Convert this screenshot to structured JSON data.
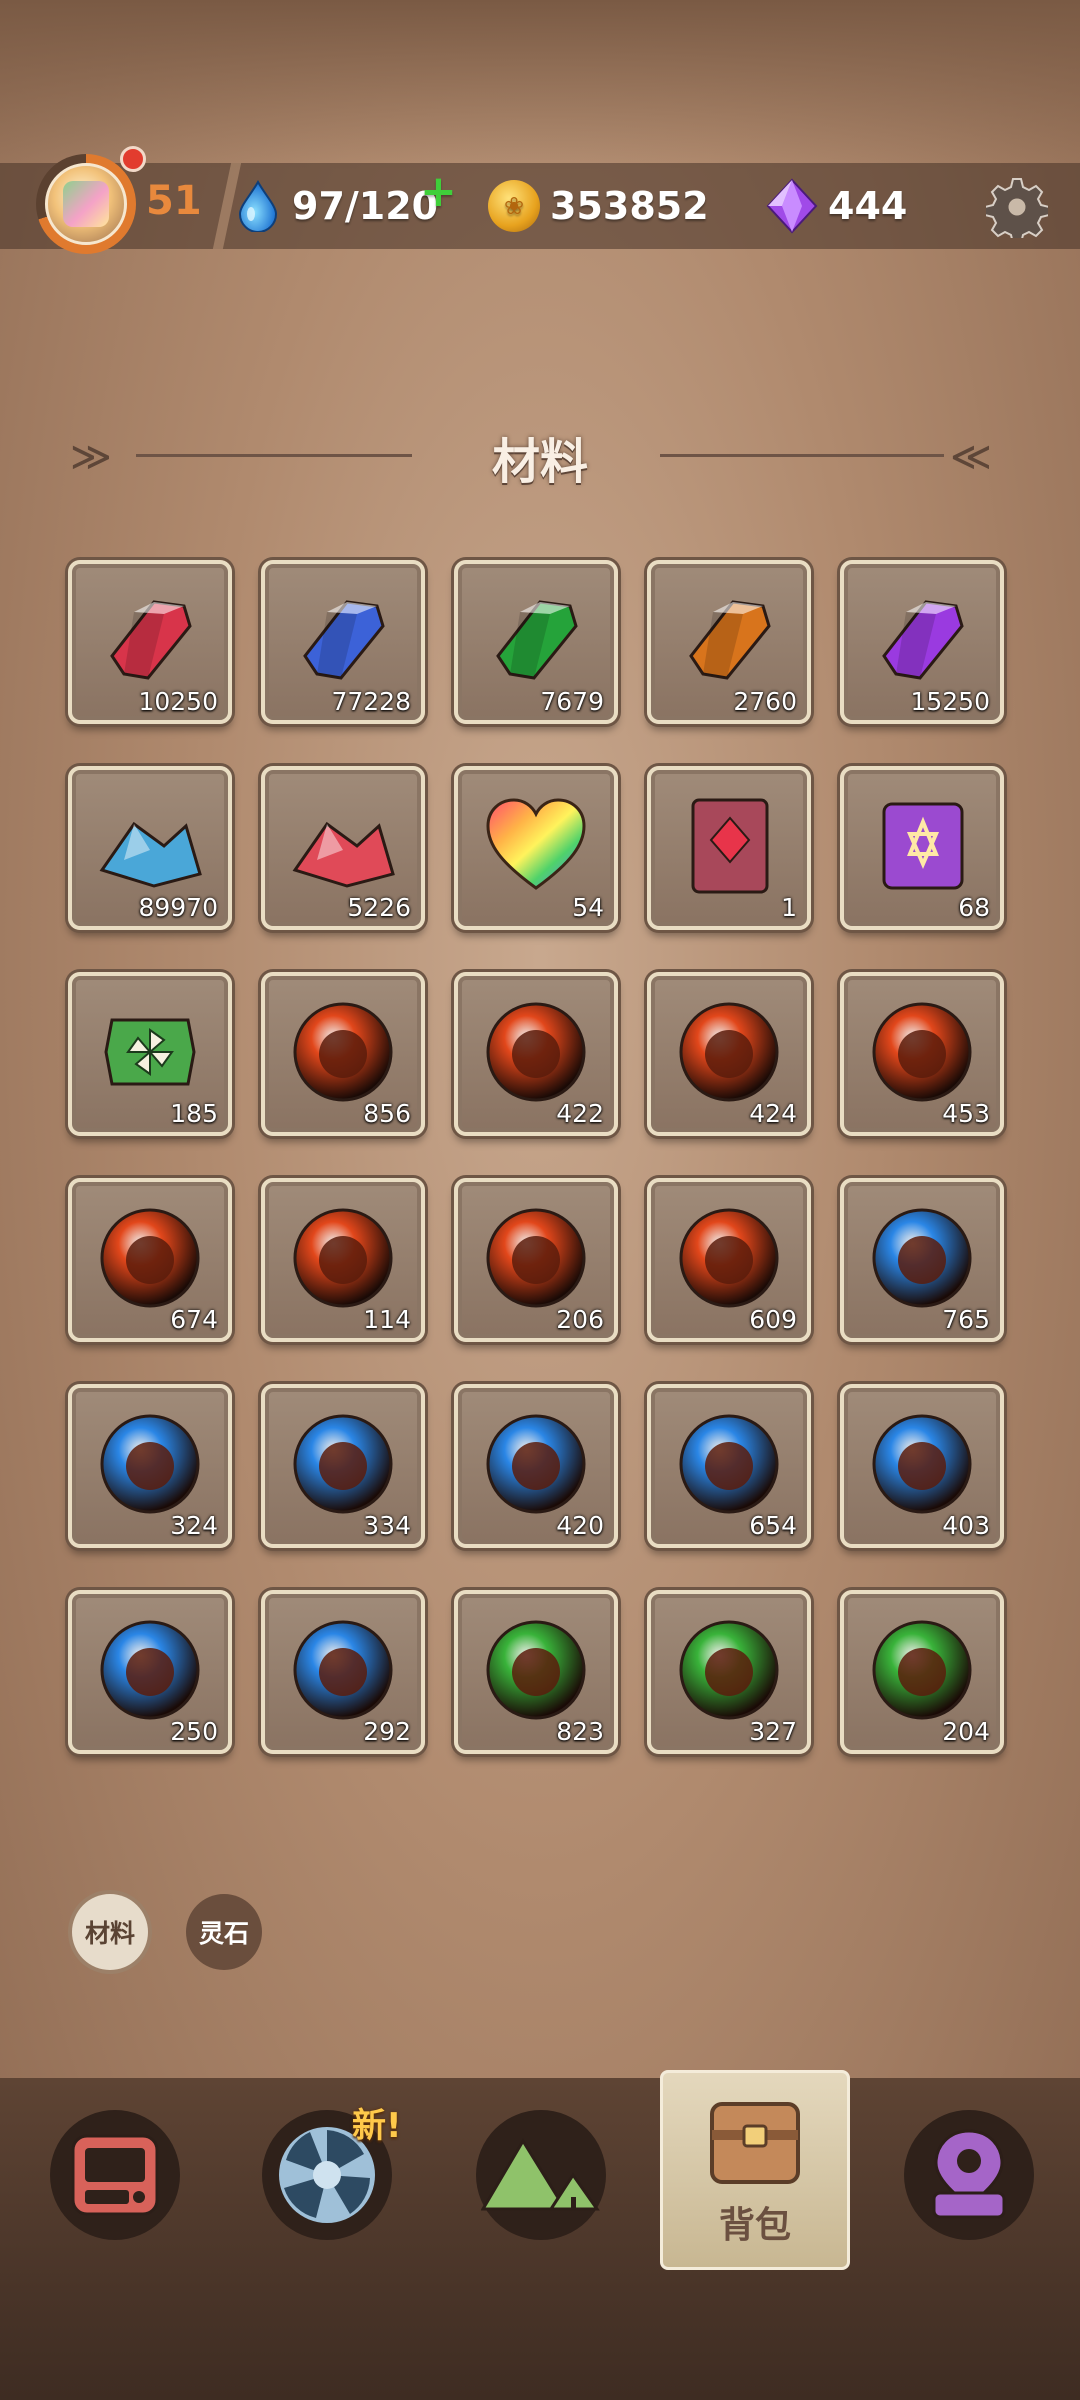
{
  "header": {
    "level": "51",
    "energy": "97/120",
    "coins": "353852",
    "gems": "444"
  },
  "section_title": "材料",
  "items": [
    {
      "icon": "red-crystal-icon",
      "color": "#d8344a",
      "qty": "10250"
    },
    {
      "icon": "blue-crystal-icon",
      "color": "#3c62d8",
      "qty": "77228"
    },
    {
      "icon": "green-crystal-icon",
      "color": "#25a33a",
      "qty": "7679"
    },
    {
      "icon": "orange-crystal-icon",
      "color": "#d8741c",
      "qty": "2760"
    },
    {
      "icon": "purple-crystal-icon",
      "color": "#9a3ae0",
      "qty": "15250"
    },
    {
      "icon": "blue-ore-pile-icon",
      "color": "#4aa7d8",
      "qty": "89970"
    },
    {
      "icon": "red-ore-pile-icon",
      "color": "#e04a58",
      "qty": "5226"
    },
    {
      "icon": "rainbow-heart-icon",
      "color": "#ff5a5a",
      "qty": "54"
    },
    {
      "icon": "red-book-icon",
      "color": "#b0485a",
      "qty": "1"
    },
    {
      "icon": "purple-star-card-icon",
      "color": "#9b4ad0",
      "qty": "68"
    },
    {
      "icon": "green-pinwheel-ticket-icon",
      "color": "#4aa84a",
      "qty": "185"
    },
    {
      "icon": "fire-orb-devil-icon",
      "color": "#e2471b",
      "qty": "856"
    },
    {
      "icon": "fire-orb-house-icon",
      "color": "#e2471b",
      "qty": "422"
    },
    {
      "icon": "fire-orb-flame-icon",
      "color": "#e2471b",
      "qty": "424"
    },
    {
      "icon": "fire-orb-bird-icon",
      "color": "#e2471b",
      "qty": "453"
    },
    {
      "icon": "fire-orb-tombstone-icon",
      "color": "#e2471b",
      "qty": "674"
    },
    {
      "icon": "fire-orb-wolf-icon",
      "color": "#e2471b",
      "qty": "114"
    },
    {
      "icon": "fire-orb-beast-icon",
      "color": "#e2471b",
      "qty": "206"
    },
    {
      "icon": "fire-orb-ox-icon",
      "color": "#e2471b",
      "qty": "609"
    },
    {
      "icon": "water-orb-goblin-icon",
      "color": "#2a86e6",
      "qty": "765"
    },
    {
      "icon": "water-orb-sprout-icon",
      "color": "#2a86e6",
      "qty": "324"
    },
    {
      "icon": "water-orb-fish-icon",
      "color": "#2a86e6",
      "qty": "334"
    },
    {
      "icon": "water-orb-cow-icon",
      "color": "#2a86e6",
      "qty": "420"
    },
    {
      "icon": "water-orb-horn-icon",
      "color": "#2a86e6",
      "qty": "654"
    },
    {
      "icon": "water-orb-dragon-icon",
      "color": "#2a86e6",
      "qty": "403"
    },
    {
      "icon": "water-orb-drop-icon",
      "color": "#2a86e6",
      "qty": "250"
    },
    {
      "icon": "water-orb-cloud-icon",
      "color": "#2a86e6",
      "qty": "292"
    },
    {
      "icon": "wood-orb-diamond-icon",
      "color": "#39b33a",
      "qty": "823"
    },
    {
      "icon": "wood-orb-bear-icon",
      "color": "#39b33a",
      "qty": "327"
    },
    {
      "icon": "wood-orb-ghost-icon",
      "color": "#39b33a",
      "qty": "204"
    }
  ],
  "filters": {
    "materials": "材料",
    "spirit_stones": "灵石"
  },
  "nav": {
    "new_badge": "新!",
    "bag_label": "背包"
  }
}
